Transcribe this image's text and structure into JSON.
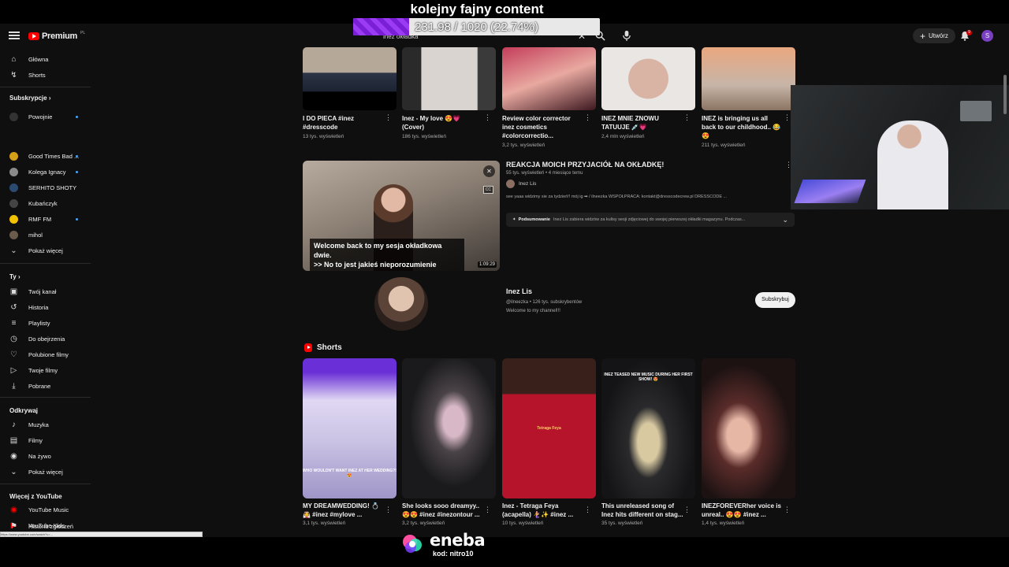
{
  "stream_overlay": {
    "title": "kolejny fajny content",
    "goal_text": "231.98 / 1020 (22.74%)",
    "goal_fraction": 0.2274
  },
  "topbar": {
    "logo_text": "Premium",
    "logo_sup": "PL",
    "search_query": "inez okładka",
    "create_label": "Utwórz",
    "notif_count": "9",
    "avatar_letter": "S"
  },
  "sidebar": {
    "main_items": [
      {
        "label": "Główna",
        "icon": "home-icon"
      },
      {
        "label": "Shorts",
        "icon": "shorts-icon"
      }
    ],
    "subs_heading": "Subskrypcje",
    "subscriptions": [
      {
        "label": "Powojnie",
        "color": "#333333",
        "dot": true
      },
      {
        "label": "Good Times Bad ...",
        "color": "#d4a017",
        "dot": true
      },
      {
        "label": "Kolega Ignacy",
        "color": "#8a8a8a",
        "dot": true
      },
      {
        "label": "SERHITO SHOTY",
        "color": "#2b4a6f",
        "dot": false
      },
      {
        "label": "Kubańczyk",
        "color": "#444444",
        "dot": false
      },
      {
        "label": "RMF FM",
        "color": "#f2c200",
        "dot": true
      },
      {
        "label": "mihol",
        "color": "#6b5b4b",
        "dot": false
      }
    ],
    "subs_more": "Pokaż więcej",
    "you_heading": "Ty",
    "you_items": [
      {
        "label": "Twój kanał",
        "icon": "channel-icon"
      },
      {
        "label": "Historia",
        "icon": "history-icon"
      },
      {
        "label": "Playlisty",
        "icon": "playlist-icon"
      },
      {
        "label": "Do obejrzenia",
        "icon": "watch-later-icon"
      },
      {
        "label": "Polubione filmy",
        "icon": "like-icon"
      },
      {
        "label": "Twoje filmy",
        "icon": "your-videos-icon"
      },
      {
        "label": "Pobrane",
        "icon": "download-icon"
      }
    ],
    "explore_heading": "Odkrywaj",
    "explore_items": [
      {
        "label": "Muzyka",
        "icon": "music-icon"
      },
      {
        "label": "Filmy",
        "icon": "movies-icon"
      },
      {
        "label": "Na żywo",
        "icon": "live-icon"
      }
    ],
    "explore_more": "Pokaż więcej",
    "more_heading": "Więcej z YouTube",
    "more_items": [
      {
        "label": "YouTube Music",
        "icon": "youtube-music-icon"
      },
      {
        "label": "YouTube Kids",
        "icon": "youtube-kids-icon"
      }
    ],
    "report_history": "Historia zgłoszeń"
  },
  "top_videos": [
    {
      "title": "I DO PIECA #inez #dresscode",
      "meta": "13 tys. wyświetleń"
    },
    {
      "title": "Inez - My love 😍💗 (Cover)",
      "meta": "186 tys. wyświetleń"
    },
    {
      "title": "Review color corrector inez cosmetics #colorcorrectio...",
      "meta": "3,2 tys. wyświetleń"
    },
    {
      "title": "INEZ MNIE ZNOWU TATUUJE 💉💗",
      "meta": "2,4 mln wyświetleń"
    },
    {
      "title": "INEZ is bringing us all back to our childhood.. 😂😍",
      "meta": "211 tys. wyświetleń"
    }
  ],
  "featured": {
    "title": "REAKCJA MOICH PRZYJACIÓŁ NA OKŁADKĘ!",
    "meta": "55 tys. wyświetleń • 4 miesiące temu",
    "channel": "Inez Lis",
    "description": "see yaaa widzimy sie za tydzień!! mój ig ➡ / ilneezka WSPÓŁPRACA: kontakt@dresscodecrew.pl DRESSCODE ...",
    "caption_line1": "Welcome back to my sesja okładkowa dwie.",
    "caption_line2": ">> No to jest jakieś nieporozumienie",
    "duration": "1:09:29",
    "summary_label": "Podsumowanie",
    "summary_text": "Inez Lis zabiera widzów za kulisy sesji zdjęciowej do swojej pierwszej okładki magazynu. Podczas..."
  },
  "channel": {
    "name": "Inez Lis",
    "subline": "@ilneezka • 126 tys. subskrybentów",
    "desc": "Welcome to my channel!!!",
    "subscribe_label": "Subskrybuj"
  },
  "shorts_heading": "Shorts",
  "shorts": [
    {
      "title": "MY DREAMWEDDING! 💍👰 #inez #mylove ...",
      "meta": "3,1 tys. wyświetleń",
      "overlay": "WHO WOULDN'T WANT INEZ AT HER WEDDING?! 😍"
    },
    {
      "title": "She looks sooo dreamyy.. 😍😍 #inez #inezontour ...",
      "meta": "3,2 tys. wyświetleń",
      "overlay": ""
    },
    {
      "title": "Inez - Tetraga Feya (acapella) 🧜‍♀️✨ #inez ...",
      "meta": "10 tys. wyświetleń",
      "overlay": "Tetraga Feya"
    },
    {
      "title": "This unreleased song of Inez hits different on stag...",
      "meta": "35 tys. wyświetleń",
      "overlay": "INEZ TEASED NEW MUSIC DURING HER FIRST SHOW! 😍"
    },
    {
      "title": "INEZFOREVERher voice is unreal.. 😍😍 #inez ...",
      "meta": "1,4 tys. wyświetleń",
      "overlay": ""
    }
  ],
  "statusbar_url": "https://www.youtube.com/watch?v=...",
  "sponsor": {
    "name": "eneba",
    "code": "kod: nitro10"
  }
}
